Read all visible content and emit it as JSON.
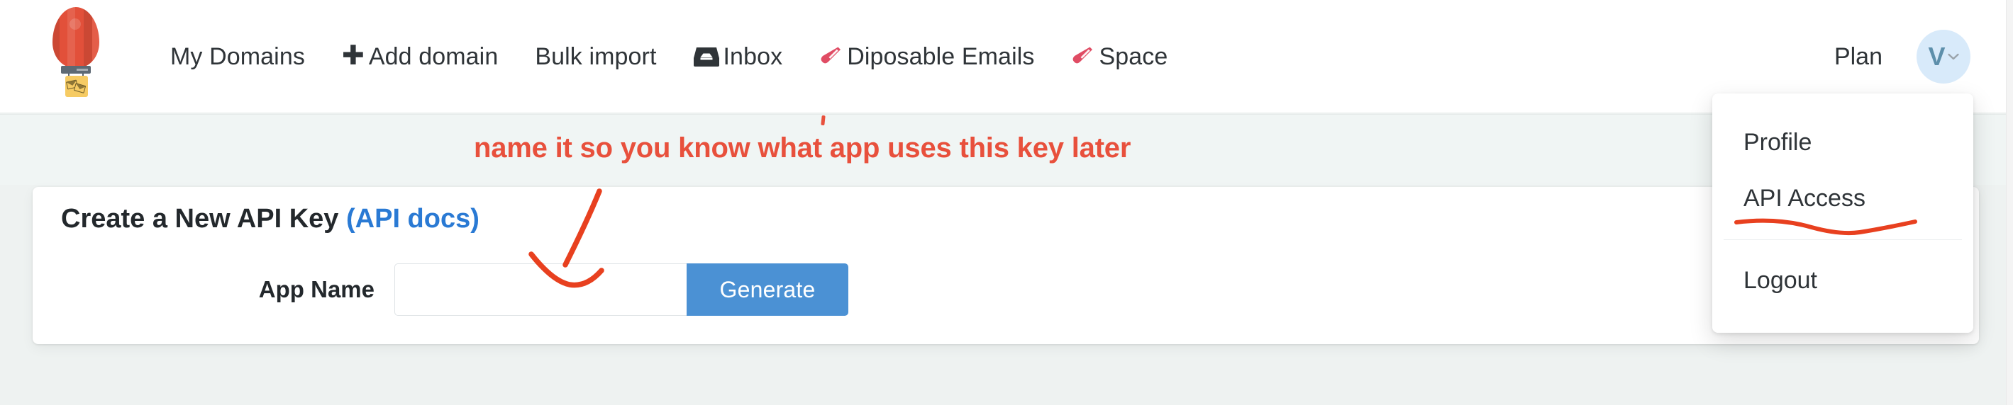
{
  "brand": {
    "logo_icon": "hot-air-balloon-mail-logo"
  },
  "nav": {
    "items": [
      {
        "label": "My Domains",
        "icon": null
      },
      {
        "label": "Add domain",
        "icon": "plus-icon"
      },
      {
        "label": "Bulk import",
        "icon": null
      },
      {
        "label": "Inbox",
        "icon": "inbox-tray-icon"
      },
      {
        "label": "Diposable Emails",
        "icon": "test-tube-icon"
      },
      {
        "label": "Space",
        "icon": "test-tube-icon"
      }
    ],
    "plan_label": "Plan",
    "avatar": {
      "initial": "V",
      "caret_icon": "chevron-down-icon",
      "bg_color": "#d8eafa",
      "text_color": "#5d8fab"
    }
  },
  "dropdown": {
    "items": [
      {
        "label": "Profile",
        "annotated": false
      },
      {
        "label": "API Access",
        "annotated": true
      },
      {
        "label": "Logout",
        "annotated": false
      }
    ],
    "annotation_color": "#e8401f"
  },
  "banner": {
    "note": "name it so you know what app uses this key later",
    "note_color": "#e8503c",
    "bg_color": "#f0f5f4"
  },
  "card": {
    "title": "Create a New API Key",
    "docs_link": "(API docs)",
    "docs_link_color": "#2a7ad4",
    "form": {
      "label": "App Name",
      "input_value": "",
      "input_placeholder": "",
      "button_label": "Generate",
      "button_color": "#4b91d4"
    }
  },
  "annotations": {
    "arrow_icon": "hand-drawn-down-arrow",
    "arrow_color": "#e8401f"
  }
}
